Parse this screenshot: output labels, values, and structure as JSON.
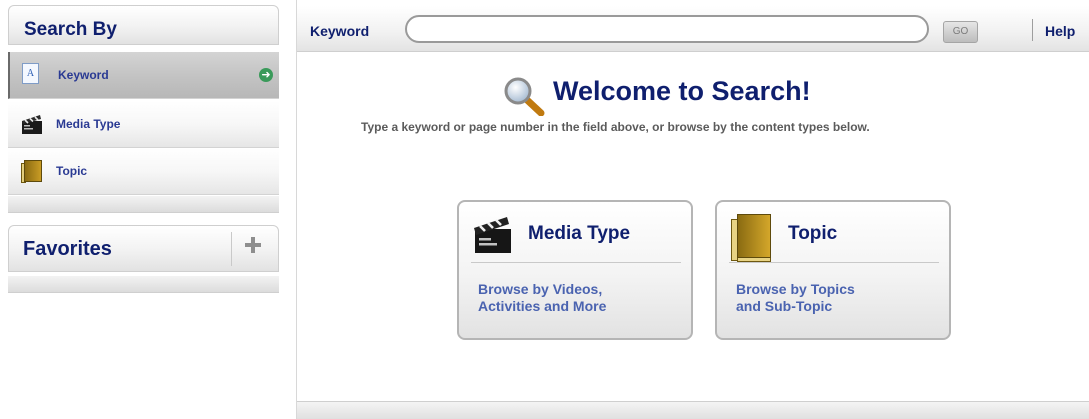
{
  "sidebar": {
    "search_by_title": "Search By",
    "items": [
      {
        "label": "Keyword",
        "icon": "keyword-document-icon",
        "icon_glyph": "A",
        "active": true
      },
      {
        "label": "Media Type",
        "icon": "clapperboard-icon",
        "active": false
      },
      {
        "label": "Topic",
        "icon": "book-icon",
        "active": false
      }
    ],
    "favorites_title": "Favorites"
  },
  "search": {
    "label": "Keyword",
    "value": "",
    "placeholder": "",
    "go_label": "GO",
    "help_label": "Help"
  },
  "welcome": {
    "title": "Welcome to Search!",
    "subtitle": "Type a keyword or page number in the field above, or browse by the content types below."
  },
  "cards": [
    {
      "title": "Media Type",
      "desc_line1": "Browse by Videos,",
      "desc_line2": "Activities and More",
      "icon": "clapperboard-icon"
    },
    {
      "title": "Topic",
      "desc_line1": "Browse by Topics",
      "desc_line2": "and Sub-Topic",
      "icon": "book-icon"
    }
  ],
  "colors": {
    "heading": "#0f1f6e",
    "link": "#4a63b0",
    "active_item": "#c4c4c4",
    "go_arrow": "#3a9a5a"
  }
}
